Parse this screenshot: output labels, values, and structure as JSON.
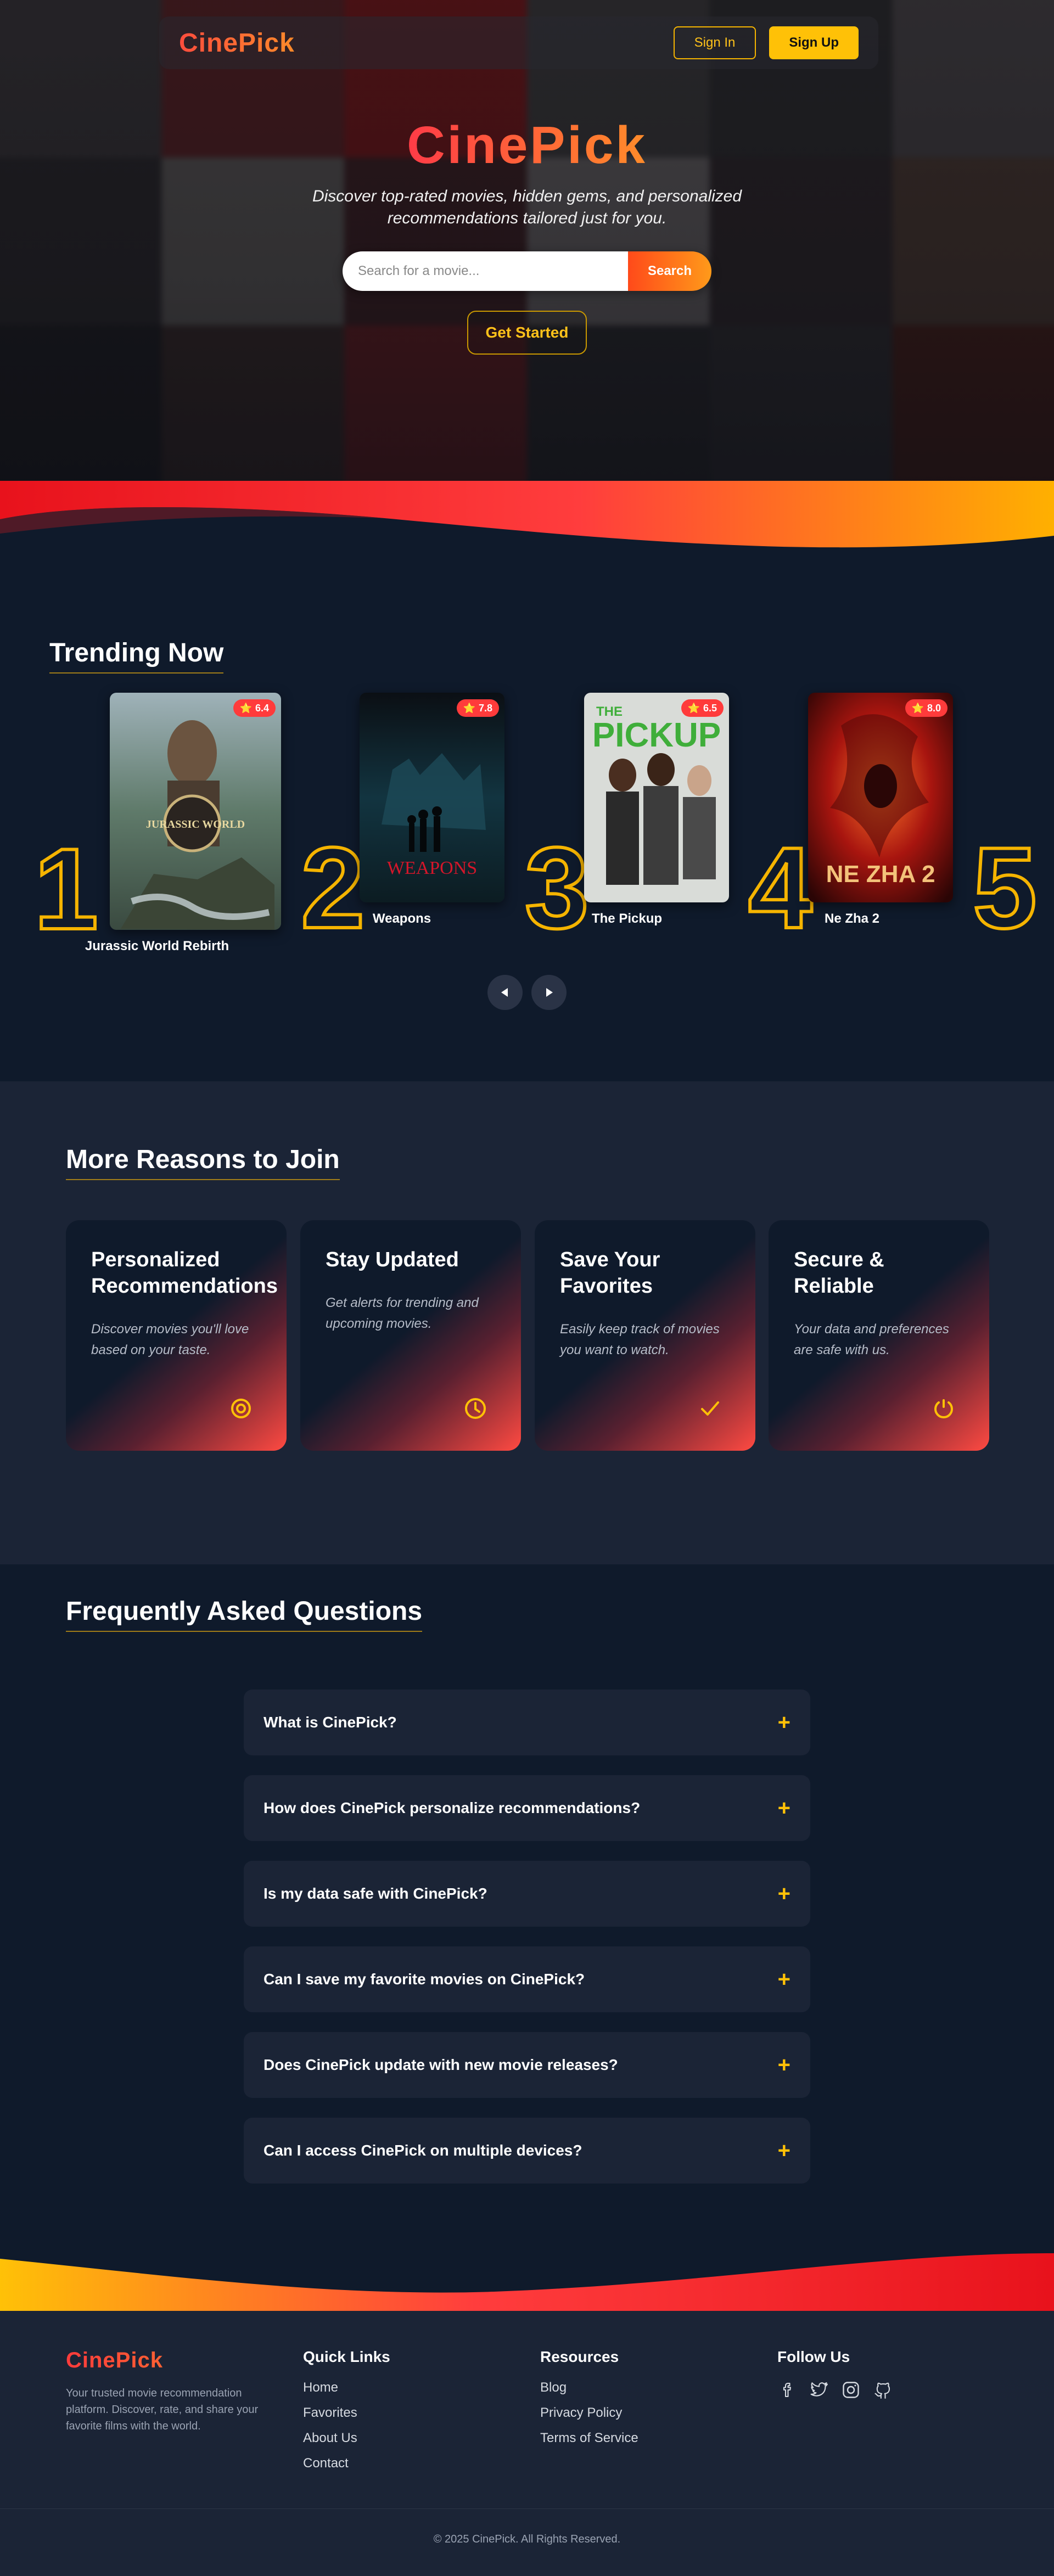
{
  "nav": {
    "logo": "CinePick",
    "sign_in": "Sign In",
    "sign_up": "Sign Up"
  },
  "hero": {
    "title": "CinePick",
    "subtitle": "Discover top-rated movies, hidden gems, and personalized recommendations tailored just for you.",
    "search_placeholder": "Search for a movie...",
    "search_button": "Search",
    "cta": "Get Started"
  },
  "trending": {
    "title": "Trending Now",
    "movies": [
      {
        "rank": "1",
        "title": "Jurassic World Rebirth",
        "rating": "6.4"
      },
      {
        "rank": "2",
        "title": "Weapons",
        "rating": "7.8"
      },
      {
        "rank": "3",
        "title": "The Pickup",
        "rating": "6.5"
      },
      {
        "rank": "4",
        "title": "Ne Zha 2",
        "rating": "8.0"
      },
      {
        "rank": "5",
        "title": "",
        "rating": ""
      }
    ],
    "poster_text": {
      "jw": "JURASSIC WORLD",
      "weapons": "WEAPONS",
      "pickup_the": "THE",
      "pickup": "PICKUP",
      "nezha": "NE ZHA 2"
    }
  },
  "reasons": {
    "title": "More Reasons to Join",
    "cards": [
      {
        "title": "Personalized Recommendations",
        "text": "Discover movies you'll love based on your taste.",
        "icon": "target-icon"
      },
      {
        "title": "Stay Updated",
        "text": "Get alerts for trending and upcoming movies.",
        "icon": "clock-icon"
      },
      {
        "title": "Save Your Favorites",
        "text": "Easily keep track of movies you want to watch.",
        "icon": "check-icon"
      },
      {
        "title": "Secure & Reliable",
        "text": "Your data and preferences are safe with us.",
        "icon": "power-icon"
      }
    ]
  },
  "faq": {
    "title": "Frequently Asked Questions",
    "items": [
      {
        "q": "What is CinePick?"
      },
      {
        "q": "How does CinePick personalize recommendations?"
      },
      {
        "q": "Is my data safe with CinePick?"
      },
      {
        "q": "Can I save my favorite movies on CinePick?"
      },
      {
        "q": "Does CinePick update with new movie releases?"
      },
      {
        "q": "Can I access CinePick on multiple devices?"
      }
    ],
    "toggle": "+"
  },
  "footer": {
    "logo": "CinePick",
    "description": "Your trusted movie recommendation platform. Discover, rate, and share your favorite films with the world.",
    "quick_links": {
      "title": "Quick Links",
      "links": [
        "Home",
        "Favorites",
        "About Us",
        "Contact"
      ]
    },
    "resources": {
      "title": "Resources",
      "links": [
        "Blog",
        "Privacy Policy",
        "Terms of Service"
      ]
    },
    "follow": {
      "title": "Follow Us",
      "icons": [
        "facebook-icon",
        "twitter-icon",
        "instagram-icon",
        "github-icon"
      ]
    },
    "copyright": "© 2025 CinePick. All Rights Reserved."
  },
  "colors": {
    "accent_yellow": "#ffc107",
    "accent_red": "#ff3b3b",
    "accent_orange": "#ff8a2a",
    "bg_dark": "#0f1a2b",
    "bg_panel": "#1b2436"
  }
}
